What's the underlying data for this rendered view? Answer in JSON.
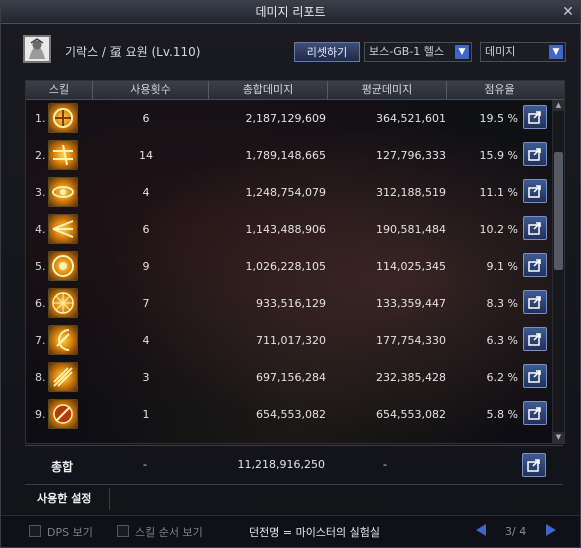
{
  "window": {
    "title": "데미지 리포트",
    "close_glyph": "✕"
  },
  "header": {
    "character": "기락스 / 虿 요원 (Lv.110)",
    "reset_label": "리셋하기",
    "boss_select": "보스-GB-1 헬스",
    "type_select": "데미지",
    "dropdown_arrow": "▼"
  },
  "columns": {
    "skill": "스킬",
    "uses": "사용횟수",
    "total": "총합데미지",
    "avg": "평균데미지",
    "share": "점유율"
  },
  "rows": [
    {
      "idx": "1.",
      "uses": "6",
      "total": "2,187,129,609",
      "avg": "364,521,601",
      "share": "19.5  %"
    },
    {
      "idx": "2.",
      "uses": "14",
      "total": "1,789,148,665",
      "avg": "127,796,333",
      "share": "15.9  %"
    },
    {
      "idx": "3.",
      "uses": "4",
      "total": "1,248,754,079",
      "avg": "312,188,519",
      "share": "11.1  %"
    },
    {
      "idx": "4.",
      "uses": "6",
      "total": "1,143,488,906",
      "avg": "190,581,484",
      "share": "10.2  %"
    },
    {
      "idx": "5.",
      "uses": "9",
      "total": "1,026,228,105",
      "avg": "114,025,345",
      "share": "9.1  %"
    },
    {
      "idx": "6.",
      "uses": "7",
      "total": "933,516,129",
      "avg": "133,359,447",
      "share": "8.3  %"
    },
    {
      "idx": "7.",
      "uses": "4",
      "total": "711,017,320",
      "avg": "177,754,330",
      "share": "6.3  %"
    },
    {
      "idx": "8.",
      "uses": "3",
      "total": "697,156,284",
      "avg": "232,385,428",
      "share": "6.2  %"
    },
    {
      "idx": "9.",
      "uses": "1",
      "total": "654,553,082",
      "avg": "654,553,082",
      "share": "5.8  %"
    }
  ],
  "summary": {
    "label": "총합",
    "uses": "-",
    "total": "11,218,916,250",
    "avg": "-"
  },
  "settings_tab": "사용한 설정",
  "footer": {
    "dps_label": "DPS 보기",
    "order_label": "스킬 순서 보기",
    "dungeon": "던전명 = 마이스터의 실험실",
    "page": "3/ 4"
  },
  "colors": {
    "accent_blue": "#3f66c9",
    "share_button": "#2c4576"
  },
  "icons": {
    "close": "close-icon",
    "share": "share-icon",
    "scroll_up": "scroll-up-icon",
    "scroll_down": "scroll-down-icon",
    "prev": "prev-page-icon",
    "next": "next-page-icon"
  }
}
